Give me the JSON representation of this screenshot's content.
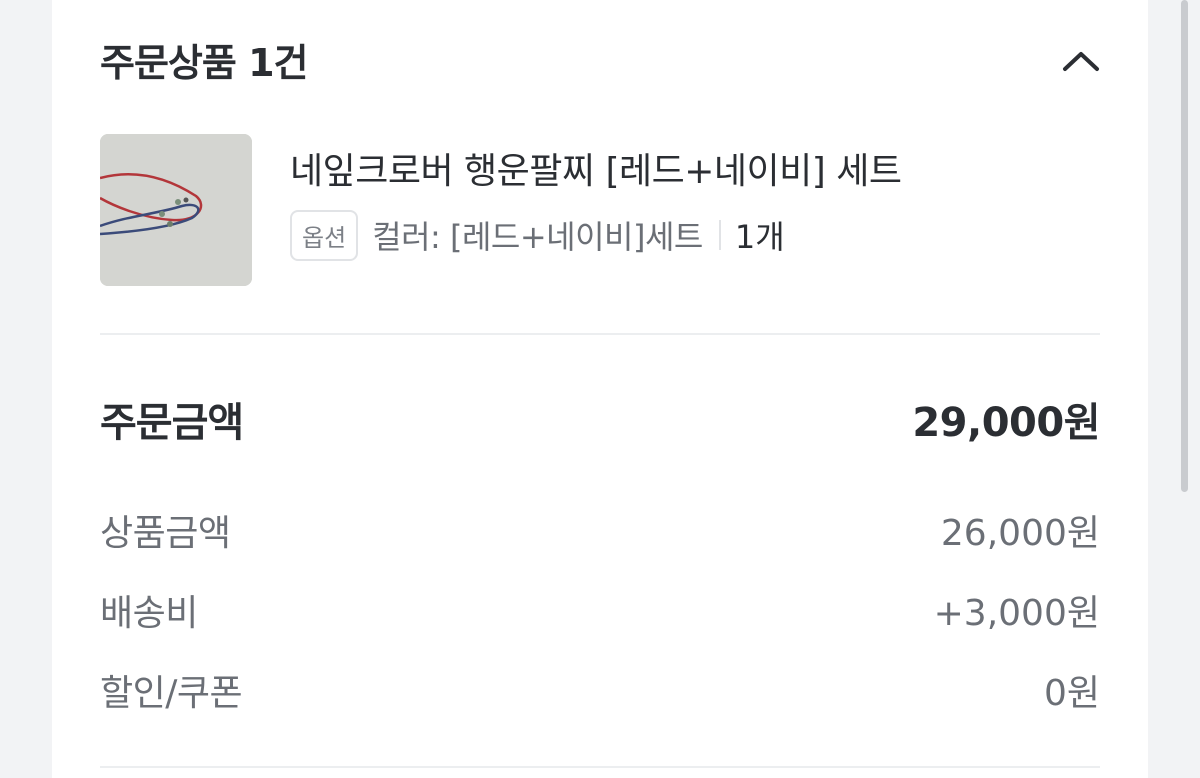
{
  "order_items": {
    "title": "주문상품 1건",
    "collapse_icon": "chevron-up-icon"
  },
  "product": {
    "name": "네잎크로버 행운팔찌 [레드+네이비] 세트",
    "option_badge": "옵션",
    "option_text": "컬러: [레드+네이비]세트",
    "quantity": "1개",
    "thumbnail_icon": "bracelet-photo"
  },
  "summary": {
    "total_label": "주문금액",
    "total_value": "29,000원",
    "rows": [
      {
        "label": "상품금액",
        "value": "26,000원"
      },
      {
        "label": "배송비",
        "value": "+3,000원"
      },
      {
        "label": "할인/쿠폰",
        "value": "0원"
      }
    ]
  },
  "colors": {
    "text_primary": "#2b2e33",
    "text_secondary": "#6b6f76",
    "divider": "#eceef0",
    "background": "#f2f3f5"
  }
}
